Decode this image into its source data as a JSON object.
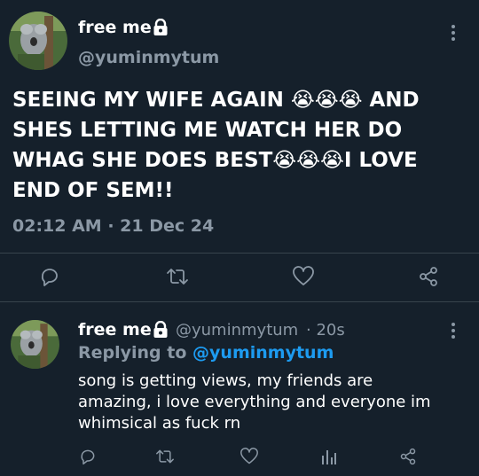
{
  "main_tweet": {
    "display_name": "free me",
    "username": "@yuminmytum",
    "text_lines": [
      "SEEING MY WIFE AGAIN 😭😭😭 AND",
      "SHES LETTING ME WATCH HER DO",
      "WHAG SHE DOES BEST😭😭😭I LOVE",
      "END OF SEM!!"
    ],
    "timestamp": "02:12 AM · 21 Dec 24"
  },
  "reply": {
    "display_name": "free me",
    "username": "@yuminmytum",
    "time": "· 20s",
    "replying_label": "Replying to",
    "replying_to": "@yuminmytum",
    "text_lines": [
      "song is getting views, my friends are",
      "amazing, i love everything and everyone im",
      "whimsical as fuck rn"
    ]
  },
  "icons": {
    "lock": "lock-icon",
    "more": "more-icon",
    "reply": "reply-icon",
    "retweet": "retweet-icon",
    "like": "like-icon",
    "share": "share-icon",
    "views": "views-icon"
  },
  "colors": {
    "background": "#15202b",
    "muted": "#8b98a5",
    "accent": "#1d9bf0",
    "divider": "#38444d"
  }
}
